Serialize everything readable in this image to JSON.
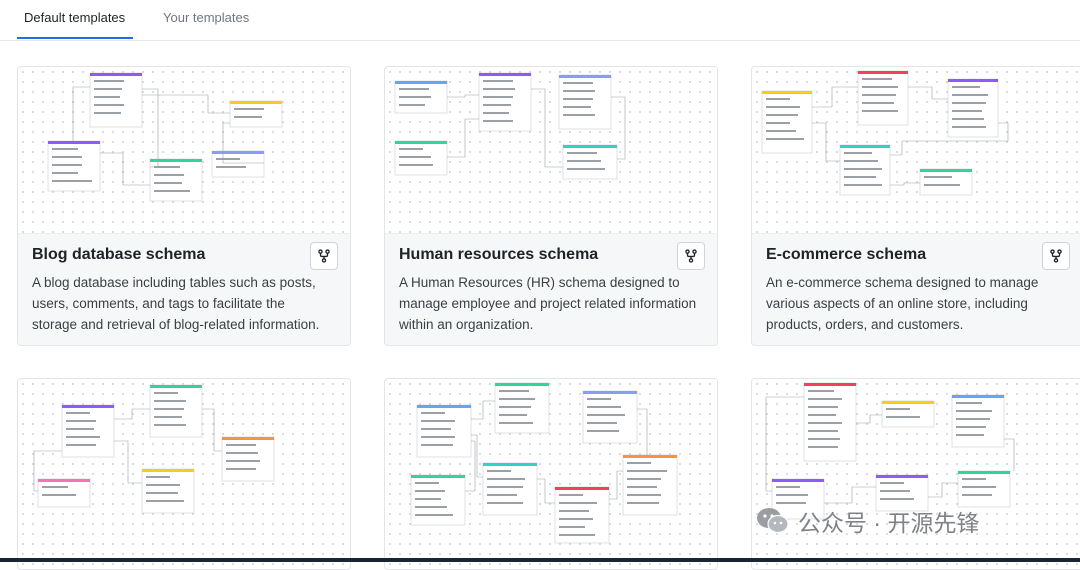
{
  "tabs": {
    "default_label": "Default templates",
    "yours_label": "Your templates"
  },
  "cards": [
    {
      "title": "Blog database schema",
      "desc": "A blog database including tables such as posts, users, comments, and tags to facilitate the storage and retrieval of blog-related information."
    },
    {
      "title": "Human resources schema",
      "desc": "A Human Resources (HR) schema designed to manage employee and project related information within an organization."
    },
    {
      "title": "E-commerce schema",
      "desc": "An e-commerce schema designed to manage various aspects of an online store, including products, orders, and customers."
    }
  ],
  "watermark": {
    "text": "公众号 · 开源先锋"
  },
  "icons": {
    "fork": "fork-icon",
    "wechat": "wechat-icon"
  },
  "colors": {
    "accent": "#1f6feb",
    "purple": "#8b5cf6",
    "yellow": "#facc15",
    "green": "#34d399",
    "blue": "#60a5fa",
    "orange": "#fb923c",
    "teal": "#2dd4bf",
    "red": "#f43f5e",
    "pink": "#f472b6"
  }
}
